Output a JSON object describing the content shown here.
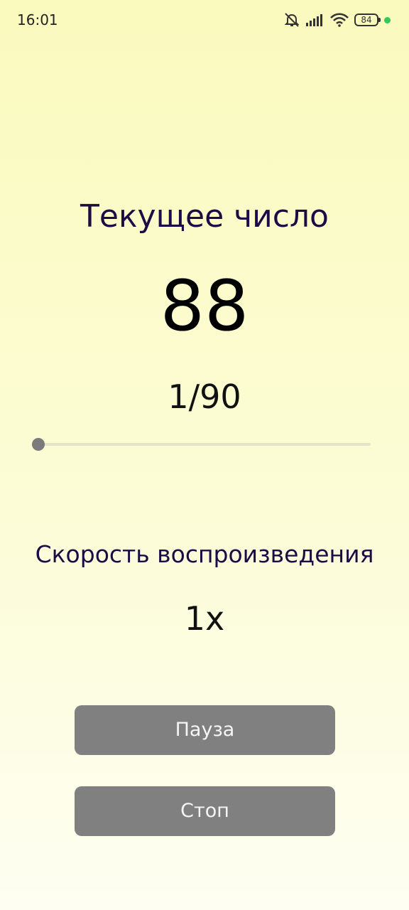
{
  "status_bar": {
    "time": "16:01",
    "battery": "84",
    "icons": [
      "muted-bell-icon",
      "signal-icon",
      "wifi-icon",
      "battery-icon",
      "privacy-dot-icon"
    ],
    "dot_color": "#34c759"
  },
  "player": {
    "current_label": "Текущее число",
    "current_number": "88",
    "progress_text": "1/90",
    "progress_position": 1,
    "progress_total": 90
  },
  "speed": {
    "label": "Скорость воспроизведения",
    "value": "1x"
  },
  "buttons": {
    "pause_label": "Пауза",
    "stop_label": "Стоп",
    "color": "#808080"
  },
  "colors": {
    "background_top": "#fafabe",
    "background_bottom": "#fefef2",
    "label_text": "#1d0b45"
  }
}
